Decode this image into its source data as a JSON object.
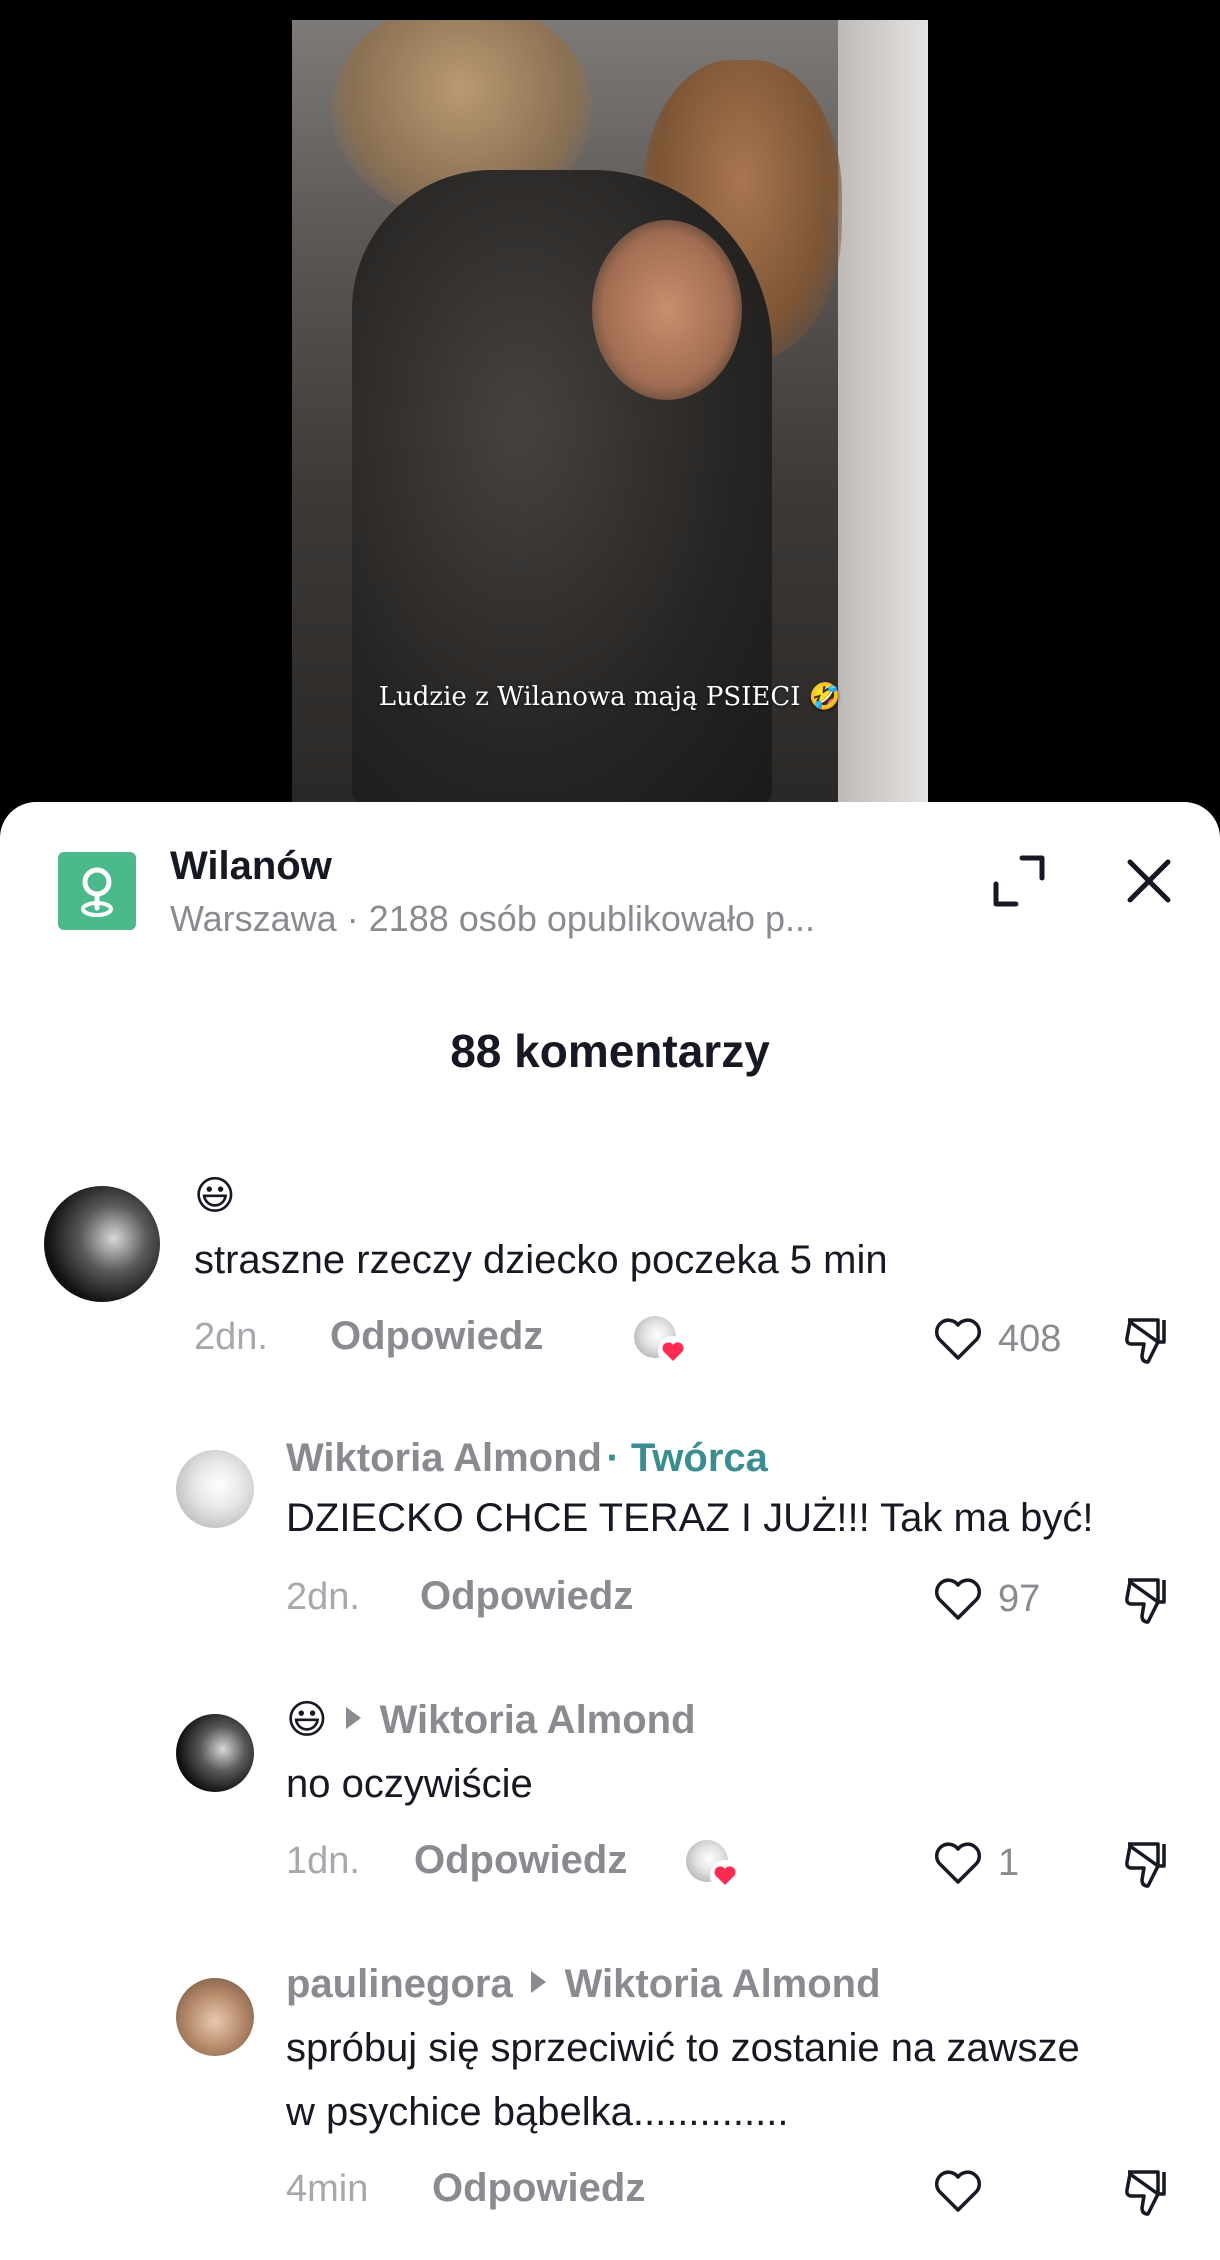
{
  "video": {
    "caption": "Ludzie z Wilanowa mają PSIECI 🤣"
  },
  "location": {
    "title": "Wilanów",
    "subtitle": "Warszawa · 2188 osób opublikowało p...",
    "accent_color": "#4cb98b"
  },
  "comments_header": "88 komentarzy",
  "comments": [
    {
      "author": "",
      "emoji": "😃",
      "text": "straszne rzeczy dziecko poczeka 5 min",
      "time": "2dn.",
      "reply_label": "Odpowiedz",
      "likes": "408",
      "creator_liked": true
    },
    {
      "author": "Wiktoria Almond",
      "creator_tag": "· Twórca",
      "text": "DZIECKO CHCE TERAZ I JUŻ!!! Tak ma być!",
      "time": "2dn.",
      "reply_label": "Odpowiedz",
      "likes": "97"
    },
    {
      "emoji": "😃",
      "reply_to": "Wiktoria Almond",
      "text": "no oczywiście",
      "time": "1dn.",
      "reply_label": "Odpowiedz",
      "likes": "1",
      "creator_liked": true
    },
    {
      "author": "paulinegora",
      "reply_to": "Wiktoria Almond",
      "text_line1": "spróbuj się sprzeciwić to zostanie na zawsze",
      "text_line2": "w psychice bąbelka..............",
      "time": "4min",
      "reply_label": "Odpowiedz",
      "likes": ""
    }
  ],
  "icons": {
    "location": "map-pin-icon",
    "expand": "expand-icon",
    "close": "close-icon",
    "like": "heart-outline-icon",
    "dislike": "thumbs-down-icon",
    "creator_like": "heart-filled-icon"
  },
  "colors": {
    "creator_tag": "#3a8e90",
    "heart_red": "#fe2c55",
    "muted": "#8a8b91"
  }
}
